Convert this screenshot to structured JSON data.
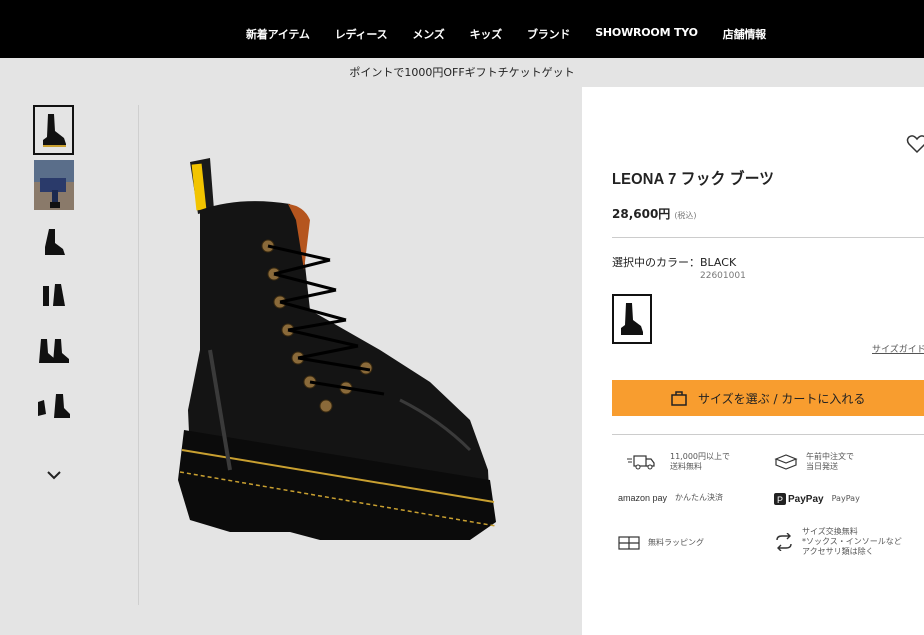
{
  "nav": {
    "items": [
      "新着アイテム",
      "レディース",
      "メンズ",
      "キッズ",
      "ブランド",
      "SHOWROOM TYO",
      "店舗情報"
    ]
  },
  "promo": {
    "text": "ポイントで1000円OFFギフトチケットゲット"
  },
  "gallery": {
    "thumbnail_count": 6,
    "active_index": 0
  },
  "product": {
    "title": "LEONA 7 フック ブーツ",
    "price": "28,600円",
    "tax_note": "(税込)",
    "color_label": "選択中のカラー：BLACK",
    "sku": "22601001",
    "size_guide": "サイズガイド",
    "cart_button": "サイズを選ぶ / カートに入れる"
  },
  "features": [
    {
      "icon": "truck-icon",
      "lines": [
        "11,000円以上で",
        "送料無料"
      ]
    },
    {
      "icon": "box-icon",
      "lines": [
        "午前中注文で",
        "当日発送"
      ]
    },
    {
      "icon": "amazon-pay-logo",
      "logo": "amazon pay",
      "text": "かんたん決済"
    },
    {
      "icon": "paypay-logo",
      "logo": "PayPay",
      "text": "PayPay"
    },
    {
      "icon": "gift-wrap-icon",
      "text": "無料ラッピング"
    },
    {
      "icon": "exchange-icon",
      "lines": [
        "サイズ交換無料",
        "*ソックス・インソールなど",
        "アクセサリ類は除く"
      ]
    }
  ],
  "colors": {
    "accent": "#f89d2f",
    "nav_bg": "#000000",
    "page_bg": "#e4e4e4"
  }
}
